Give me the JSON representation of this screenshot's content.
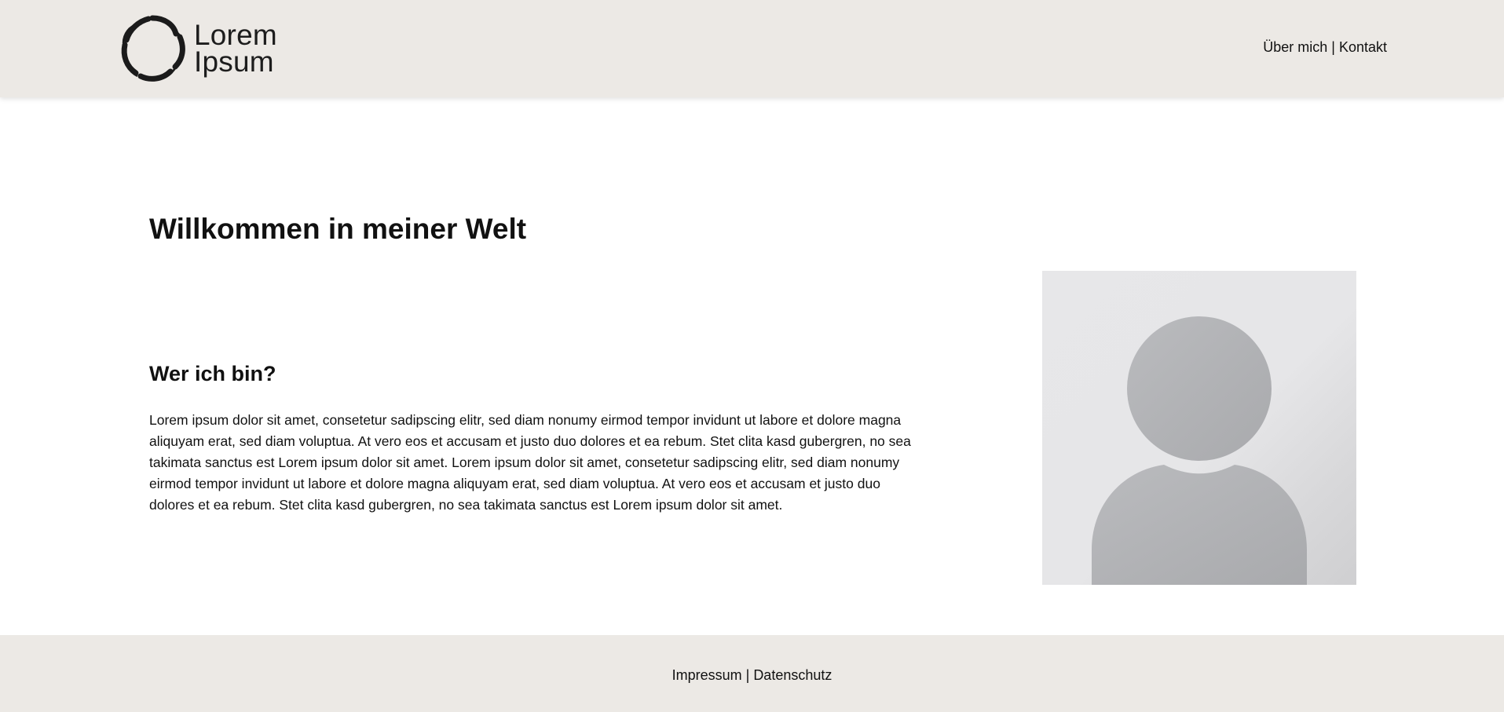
{
  "header": {
    "logo": {
      "line1": "Lorem",
      "line2": "Ipsum",
      "icon": "flower-ring-logo-icon"
    },
    "nav": {
      "about": "Über mich",
      "separator": "|",
      "contact": "Kontakt"
    }
  },
  "main": {
    "title": "Willkommen in meiner Welt",
    "subtitle": "Wer ich bin?",
    "paragraph": "Lorem ipsum dolor sit amet, consetetur sadipscing elitr, sed diam nonumy eirmod tempor invidunt ut labore et dolore magna aliquyam erat, sed diam voluptua. At vero eos et accusam et justo duo dolores et ea rebum. Stet clita kasd gubergren, no sea takimata sanctus est Lorem ipsum dolor sit amet. Lorem ipsum dolor sit amet, consetetur sadipscing elitr, sed diam nonumy eirmod tempor invidunt ut labore et dolore magna aliquyam erat, sed diam voluptua. At vero eos et accusam et justo duo dolores et ea rebum. Stet clita kasd gubergren, no sea takimata sanctus est Lorem ipsum dolor sit amet.",
    "avatar": {
      "icon": "user-placeholder-icon"
    }
  },
  "footer": {
    "nav": {
      "imprint": "Impressum",
      "separator": "|",
      "privacy": "Datenschutz"
    }
  },
  "colors": {
    "header_bg": "#ece9e5",
    "footer_bg": "#ece9e5",
    "text": "#111111",
    "avatar_bg": "#e6e6e8",
    "avatar_figure": "#b7b8bb"
  }
}
